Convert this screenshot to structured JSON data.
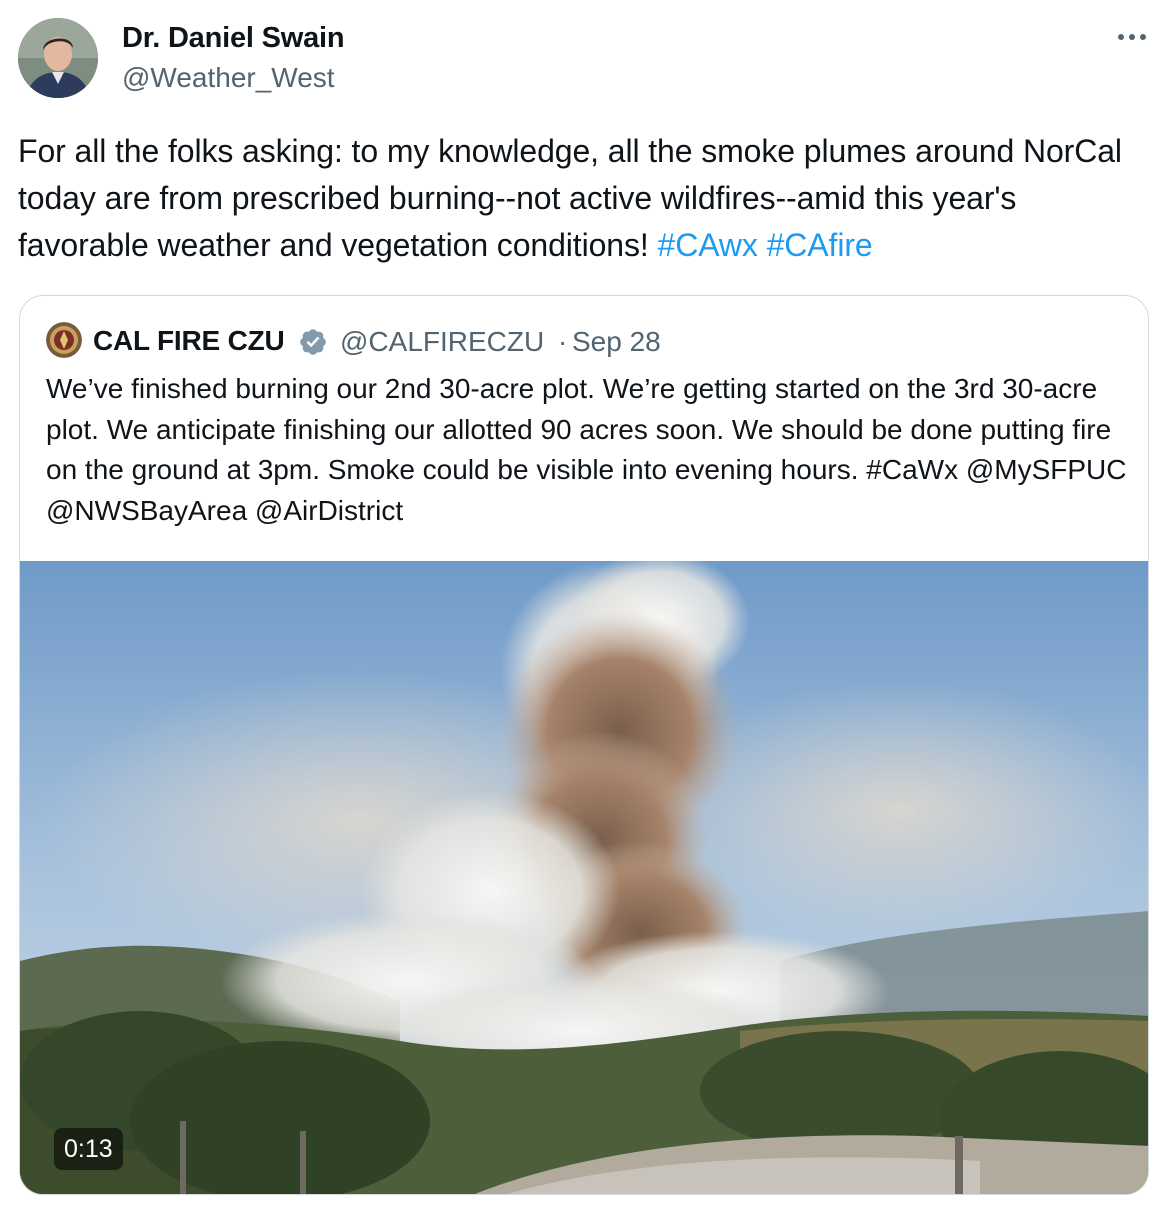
{
  "author": {
    "name": "Dr. Daniel Swain",
    "handle": "@Weather_West",
    "avatar_icon": "person-avatar"
  },
  "more_icon": "more-horizontal-icon",
  "tweet": {
    "text": "For all the folks asking: to my knowledge, all the smoke plumes around NorCal today are from prescribed burning--not active wildfires--amid this year's favorable weather and vegetation conditions! ",
    "hashtags": [
      "#CAwx",
      "#CAfire"
    ]
  },
  "quote": {
    "name": "CAL FIRE CZU",
    "verified_icon": "verified-badge-icon",
    "handle": "@CALFIRECZU",
    "separator": "·",
    "date": "Sep 28",
    "text": "We’ve finished burning our 2nd 30-acre plot. We’re getting started on the 3rd 30-acre plot. We anticipate finishing our allotted 90 acres soon. We should be done putting fire on the ground at 3pm. Smoke could be visible into evening hours. #CaWx @MySFPUC @NWSBayArea @AirDistrict",
    "media": {
      "type": "video",
      "duration": "0:13"
    }
  },
  "colors": {
    "text": "#0f1419",
    "secondary": "#536471",
    "link": "#1d9bf0",
    "border": "#cfd9de",
    "verified": "#829aab"
  }
}
